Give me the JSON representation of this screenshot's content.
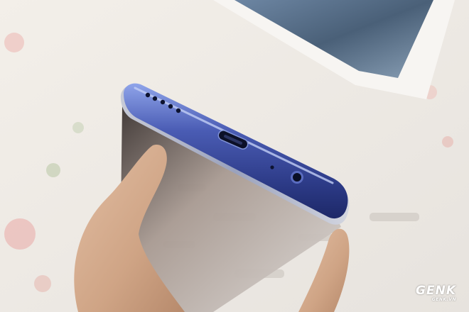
{
  "photo": {
    "subject": "phone-bottom-edge",
    "colors": {
      "phone_body": "#3a4a9a",
      "phone_highlight": "#8aa0e6",
      "skin": "#d9b49a",
      "background": "#eeeae6",
      "artwork": "#5a7290"
    }
  },
  "watermark": {
    "brand": "GENK",
    "site": "GENK.VN"
  }
}
